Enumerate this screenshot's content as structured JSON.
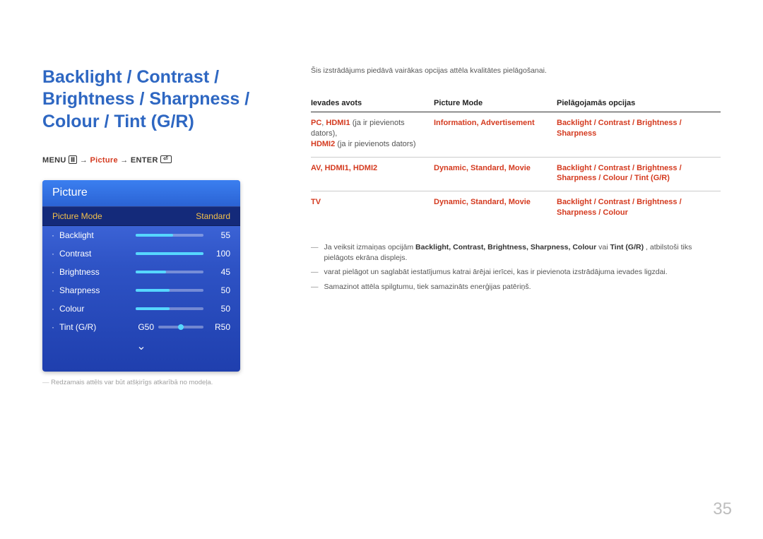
{
  "title": "Backlight / Contrast / Brightness / Sharpness / Colour / Tint (G/R)",
  "menu_path": {
    "menu": "MENU",
    "arrow": " → ",
    "hl": "Picture",
    "enter": "ENTER"
  },
  "osd": {
    "header": "Picture",
    "picmode_label": "Picture Mode",
    "picmode_value": "Standard",
    "rows": [
      {
        "label": "Backlight",
        "value": 55,
        "pct": 55
      },
      {
        "label": "Contrast",
        "value": 100,
        "pct": 100
      },
      {
        "label": "Brightness",
        "value": 45,
        "pct": 45
      },
      {
        "label": "Sharpness",
        "value": 50,
        "pct": 50
      },
      {
        "label": "Colour",
        "value": 50,
        "pct": 50
      }
    ],
    "tint": {
      "label": "Tint (G/R)",
      "g": "G50",
      "r": "R50",
      "pos_pct": 50
    },
    "chevron": "⌄",
    "note": "Redzamais attēls var būt atšķirīgs atkarībā no modeļa."
  },
  "intro": "Šis izstrādājums piedāvā vairākas opcijas attēla kvalitātes pielāgošanai.",
  "table": {
    "headers": {
      "c1": "Ievades avots",
      "c2": "Picture Mode",
      "c3": "Pielāgojamās opcijas"
    },
    "rows": [
      {
        "c1_red1": "PC",
        "c1_red2": "HDMI1",
        "c1_tail1": " (ja ir pievienots dators),",
        "c1_line2_red": "HDMI2",
        "c1_line2_tail": " (ja ir pievienots dators)",
        "c2": "Information, Advertisement",
        "c3_l1": "Backlight / Contrast / Brightness /",
        "c3_l2": "Sharpness"
      },
      {
        "c1": "AV, HDMI1, HDMI2",
        "c2": "Dynamic, Standard, Movie",
        "c3_l1": "Backlight / Contrast / Brightness /",
        "c3_l2": "Sharpness / Colour / Tint (G/R)"
      },
      {
        "c1": "TV",
        "c2": "Dynamic, Standard, Movie",
        "c3_l1": "Backlight / Contrast / Brightness /",
        "c3_l2": "Sharpness / Colour"
      }
    ]
  },
  "bullets": {
    "b1_pre": "Ja veiksit izmaiņas opcijām ",
    "b1_terms": "Backlight, Contrast, Brightness, Sharpness, Colour",
    "b1_mid": " vai ",
    "b1_term2": "Tint (G/R)",
    "b1_post": ", atbilstoši tiks pielāgots ekrāna displejs.",
    "b2": "varat pielāgot un saglabāt iestatījumus katrai ārējai ierīcei, kas ir pievienota izstrādājuma ievades ligzdai.",
    "b3": "Samazinot attēla spilgtumu, tiek samazināts enerģijas patēriņš."
  },
  "page_number": "35",
  "chart_data": {
    "type": "table",
    "sliders": [
      {
        "name": "Backlight",
        "value": 55,
        "min": 0,
        "max": 100
      },
      {
        "name": "Contrast",
        "value": 100,
        "min": 0,
        "max": 100
      },
      {
        "name": "Brightness",
        "value": 45,
        "min": 0,
        "max": 100
      },
      {
        "name": "Sharpness",
        "value": 50,
        "min": 0,
        "max": 100
      },
      {
        "name": "Colour",
        "value": 50,
        "min": 0,
        "max": 100
      },
      {
        "name": "Tint (G/R)",
        "g": 50,
        "r": 50
      }
    ]
  }
}
